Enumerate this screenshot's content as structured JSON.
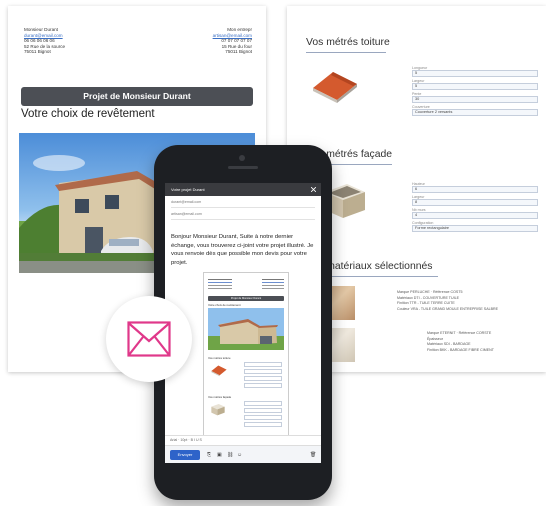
{
  "colors": {
    "accent_envelope": "#e0388a",
    "banner": "#4c4f55",
    "link": "#3a6fc4",
    "send_button": "#2e63c9"
  },
  "left_doc": {
    "client": {
      "name": "Monsieur Durant",
      "email": "durant@email.com",
      "phone": "06 06 06 06 06",
      "address": "52 Rue de la source",
      "city": "75011 Bignot"
    },
    "company": {
      "name": "Mon entrepr",
      "email": "artisan@email.com",
      "phone": "07 07 07 07 07",
      "address": "15 Rue du four",
      "city": "75011 Bignot"
    },
    "banner": "Projet de Monsieur Durant",
    "heading": "Votre choix de revêtement"
  },
  "right_doc": {
    "toiture_title": "Vos métrés toiture",
    "toiture_fields": [
      {
        "label": "Longueur",
        "value": "5"
      },
      {
        "label": "Largeur",
        "value": "5"
      },
      {
        "label": "Pente",
        "value": "30"
      },
      {
        "label": "Couverture",
        "value": "Couverture 2 versants"
      }
    ],
    "facade_title": "Vos métrés façade",
    "facade_fields": [
      {
        "label": "Hauteur",
        "value": "6"
      },
      {
        "label": "Largeur",
        "value": "8"
      },
      {
        "label": "Nb murs",
        "value": "4"
      },
      {
        "label": "Configuration",
        "value": "Forme rectangulaire"
      }
    ],
    "materials_title": "Vos matériaux sélectionnés",
    "material1_lines": [
      "Marque PERLUCHE · Référence COST5",
      "Matériaux DTI - COUVERTURE TUILE",
      "Finition TTR - TUILE TERRE CUITE",
      "Couleur VRA - TUILE GRAND MOULE ENTREPRISE SALBRE"
    ],
    "material2_lines": [
      "Marque ETERNIT · Référence CORSTE",
      "Épaisseur",
      "Matériaux SDI - BARDAGE",
      "Finition BKK - BARDAGE FIBRE CIMENT"
    ]
  },
  "phone": {
    "email_title": "Votre projet Durant",
    "from": "durant@email.com",
    "to": "artisan@email.com",
    "body": "Bonjour Monsieur Durant, Suite à notre dernier échange, vous trouverez ci-joint votre projet illustré. Je vous renvoie dès que possible mon devis pour votre projet.",
    "thumb_banner": "Projet de Monsieur Durant",
    "thumb_heading": "Votre choix de revêtement",
    "thumb_sec1": "Vos métrés toiture",
    "thumb_sec2": "Vos métrés façade",
    "toolbar": "Arial · 10pt · B I U S",
    "send_label": "Envoyer"
  },
  "icons": {
    "envelope": "envelope-icon",
    "attach": "paperclip-icon",
    "image": "image-icon",
    "link": "link-icon",
    "emoji": "emoji-icon",
    "trash": "trash-icon"
  }
}
